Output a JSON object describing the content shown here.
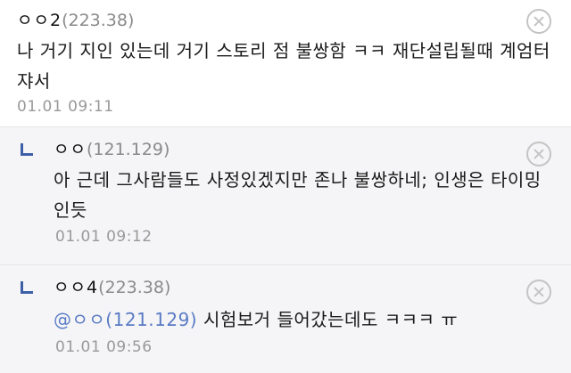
{
  "comments": [
    {
      "nickname": "ㅇㅇ2",
      "ip": "(223.38)",
      "text": "나 거기 지인 있는데 거기 스토리 점 불쌍함 ㅋㅋ 재단설립될때 계엄터쟈서",
      "time": "01.01 09:11"
    },
    {
      "nickname": "ㅇㅇ",
      "ip": "(121.129)",
      "text": "아 근데 그사람들도 사정있겠지만 존나 불쌍하네; 인생은 타이밍인듯",
      "time": "01.01 09:12"
    },
    {
      "nickname": "ㅇㅇ4",
      "ip": "(223.38)",
      "mention": "@ㅇㅇ(121.129)",
      "text": " 시험보거 들어갔는데도 ㅋㅋㅋ ㅠ",
      "time": "01.01 09:56"
    }
  ],
  "icons": {
    "reply": "reply-arrow-icon",
    "delete": "delete-circle-x-icon"
  },
  "colors": {
    "reply_background": "#f5f5f7",
    "mention": "#5a7bc4",
    "reply_mark": "#3d5fa8",
    "meta_gray": "#999999"
  }
}
